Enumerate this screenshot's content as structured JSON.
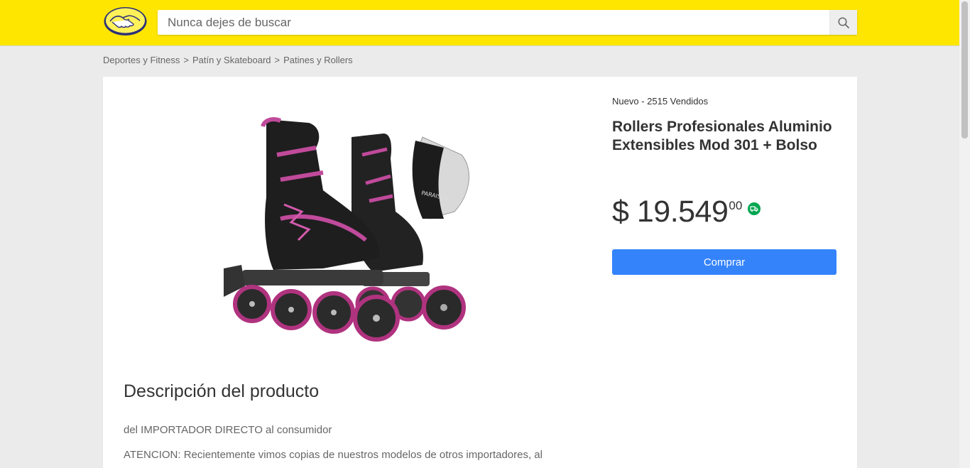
{
  "header": {
    "search_placeholder": "Nunca dejes de buscar",
    "brand_color": "#ffe600"
  },
  "breadcrumb": [
    "Deportes y Fitness",
    "Patín y Skateboard",
    "Patines y Rollers"
  ],
  "breadcrumb_separator": ">",
  "product": {
    "meta": "Nuevo - 2515 Vendidos",
    "title": "Rollers Profesionales Aluminio Extensibles Mod 301 + Bolso",
    "price_amount": "$ 19.549",
    "price_cents": "00",
    "buy_label": "Comprar",
    "buy_color": "#3483fa",
    "shipping_icon": "truck-icon",
    "image_brand_text": "PARAISON"
  },
  "description": {
    "title": "Descripción del producto",
    "p1": "del IMPORTADOR DIRECTO al consumidor",
    "p2": "ATENCION: Recientemente vimos copias de nuestros modelos de otros importadores, al"
  }
}
